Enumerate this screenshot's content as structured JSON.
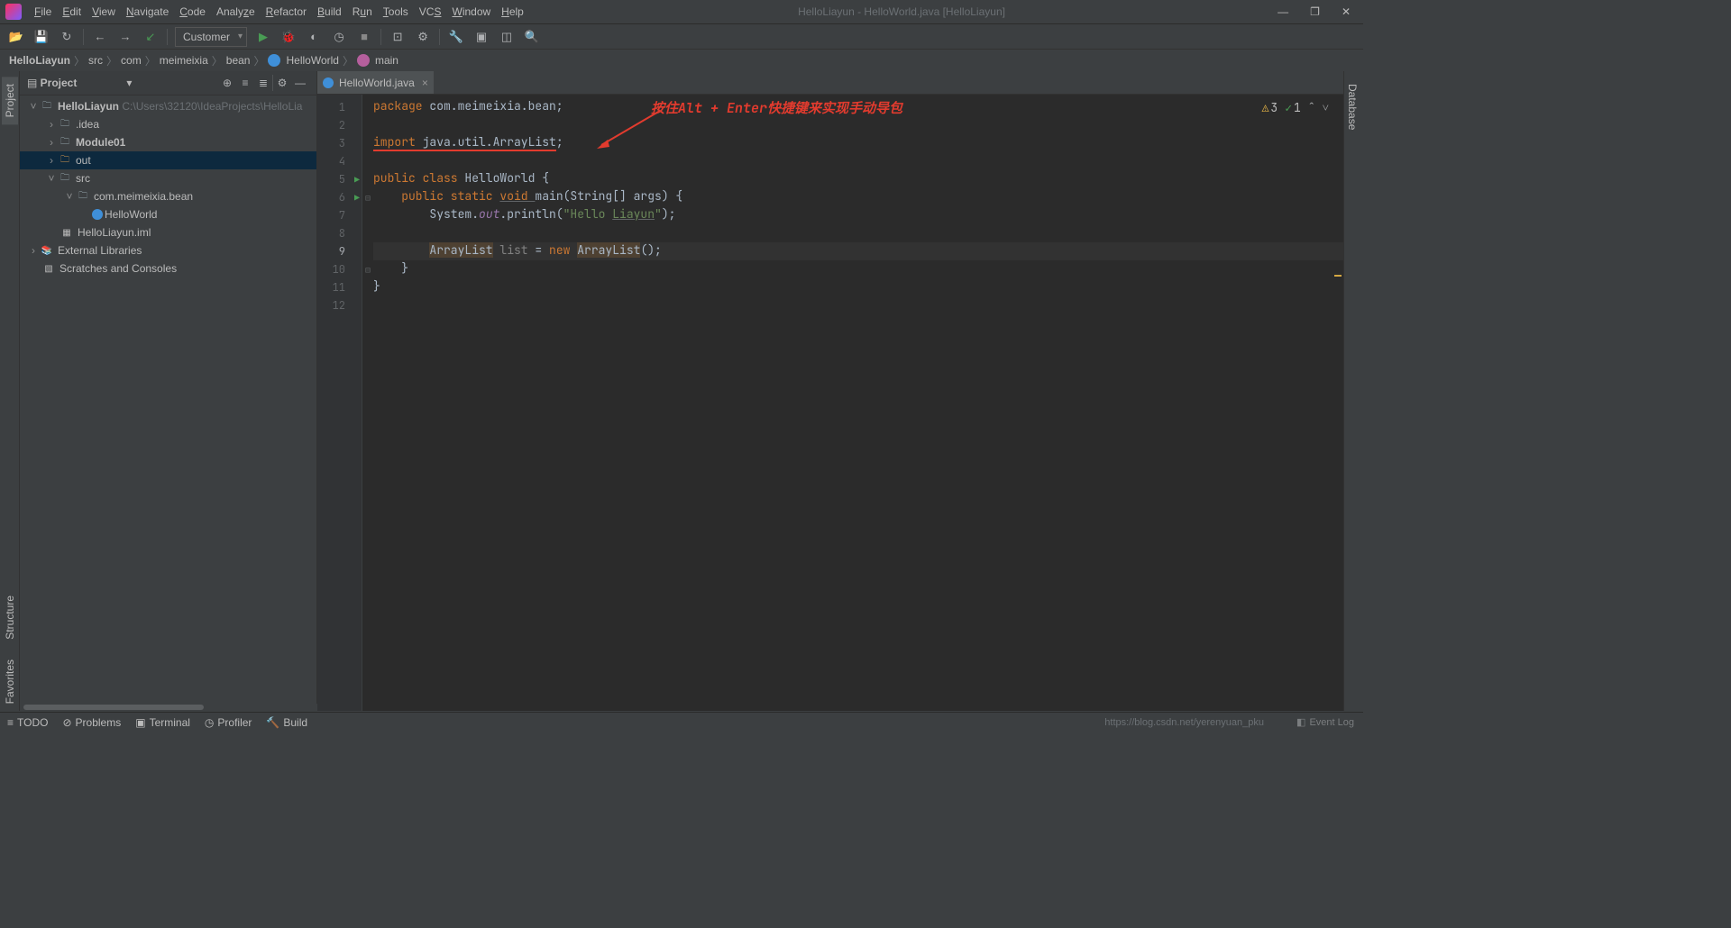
{
  "menus": [
    "File",
    "Edit",
    "View",
    "Navigate",
    "Code",
    "Analyze",
    "Refactor",
    "Build",
    "Run",
    "Tools",
    "VCS",
    "Window",
    "Help"
  ],
  "window_title": "HelloLiayun - HelloWorld.java [HelloLiayun]",
  "run_config": "Customer",
  "breadcrumb": {
    "project": "HelloLiayun",
    "parts": [
      "src",
      "com",
      "meimeixia",
      "bean"
    ],
    "class": "HelloWorld",
    "method": "main"
  },
  "sidebar": {
    "project_label": "Project",
    "structure_label": "Structure",
    "favorites_label": "Favorites",
    "database_label": "Database"
  },
  "panel": {
    "title": "Project"
  },
  "tree": {
    "root": "HelloLiayun",
    "root_path": "C:\\Users\\32120\\IdeaProjects\\HelloLia",
    "idea": ".idea",
    "module01": "Module01",
    "out": "out",
    "src": "src",
    "package": "com.meimeixia.bean",
    "class_file": "HelloWorld",
    "iml": "HelloLiayun.iml",
    "ext_lib": "External Libraries",
    "scratches": "Scratches and Consoles"
  },
  "tab": {
    "name": "HelloWorld.java"
  },
  "code": {
    "l1_package": "package ",
    "l1_rest": "com.meimeixia.bean;",
    "l3_import": "import ",
    "l3_rest": "java.util.ArrayList",
    "l3_semi": ";",
    "l5_public": "public class ",
    "l5_name": "HelloWorld ",
    "l5_brace": "{",
    "l6_mods": "    public static ",
    "l6_void": "void ",
    "l6_main": "main",
    "l6_args": "(String[] args) {",
    "l7_sys": "        System.",
    "l7_out": "out",
    "l7_println": ".println(",
    "l7_str1": "\"Hello ",
    "l7_str2": "Liayun",
    "l7_str3": "\"",
    "l7_end": ");",
    "l9_indent": "        ",
    "l9_arraylist1": "ArrayList",
    "l9_list": " list ",
    "l9_eq": "= ",
    "l9_new": "new ",
    "l9_arraylist2": "ArrayList",
    "l9_end": "();",
    "l10": "    }",
    "l11": "}"
  },
  "annotation": "按住Alt + Enter快捷键来实现手动导包",
  "inspections": {
    "warnings": "3",
    "passes": "1"
  },
  "bottom": {
    "todo": "TODO",
    "problems": "Problems",
    "terminal": "Terminal",
    "profiler": "Profiler",
    "build": "Build",
    "event_log": "Event Log",
    "url": "https://blog.csdn.net/yerenyuan_pku"
  }
}
